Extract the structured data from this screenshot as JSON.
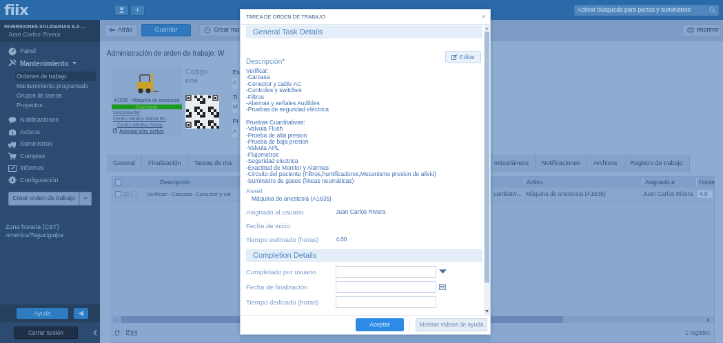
{
  "top_bar": {
    "logo": "fiix",
    "add_button": "+",
    "search": {
      "placeholder": "Activar búsqueda para piezas y suministros"
    }
  },
  "sidebar": {
    "company": "INVERSIONES SOLIDARIAS S.A ...",
    "user": "Juan Carlos Rivera",
    "items": [
      {
        "label": "Panel"
      },
      {
        "label": "Mantenimiento",
        "expanded": true,
        "children": [
          {
            "label": "Ordenes de trabajo",
            "selected": true
          },
          {
            "label": "Mantenimiento programado",
            "selected": false
          },
          {
            "label": "Grupos de tareas",
            "selected": false
          },
          {
            "label": "Proyectos",
            "selected": false
          }
        ]
      },
      {
        "label": "Notificaciones"
      },
      {
        "label": "Activos"
      },
      {
        "label": "Suministros"
      },
      {
        "label": "Compras"
      },
      {
        "label": "Informes"
      },
      {
        "label": "Configuración"
      }
    ],
    "create_button": "Crear orden de trabajo",
    "timezone": {
      "label": "Zona horaria (CST)",
      "value": "America/Tegucigalpa"
    },
    "help_button": "Ayuda",
    "logout_button": "Cerrar sesión"
  },
  "toolbar": {
    "back": "Atrás",
    "save": "Guardar",
    "create": "Crear ma",
    "print": "Imprimir"
  },
  "work_order": {
    "title": "Administración de orden de trabajo: W",
    "asset_card": {
      "name": "A1635 - Máquina de anestesia",
      "status": "Conectado",
      "disconnect": "Desconectar",
      "location": "Centro Medico Santa Ro",
      "sub_location": "Centro Médico Santa",
      "add_asset": "Agregar otro activo"
    },
    "code_label": "Código",
    "code": "6294",
    "cut_fields": [
      {
        "label": "Es",
        "value": "A"
      },
      {
        "label": "Ti",
        "value": "M"
      },
      {
        "label": "Pr",
        "value": "A"
      }
    ]
  },
  "tabs_left": [
    "General",
    "Finalización",
    "Tareas de ma"
  ],
  "tabs_right": [
    "misceláneos",
    "Notificaciones",
    "Archivos",
    "Registro de trabajo"
  ],
  "table": {
    "select_all_checked": false,
    "column_left": "Descripción",
    "columns_right": [
      "Activo",
      "Asignado a",
      "Horas"
    ],
    "row": {
      "checked": false,
      "description": "Verificar: -Carcasa -Conector y cal",
      "column_cut": "uantitativ...",
      "asset": "Máquina de anestesia (A1635)",
      "assigned": "Juan Carlos Rivera",
      "hours": "4.0"
    },
    "footer": "1 registro."
  },
  "dialog": {
    "title": "TAREA DE ORDEN DE TRABAJO",
    "close": "×",
    "general_header": "General Task Details",
    "edit_button": "Editar",
    "description_label": "Descripción*",
    "description_blocks": [
      [
        "Verificar:",
        "-Carcasa",
        "-Conector y cable AC",
        "-Controles y switches",
        "-Filtros",
        "-Alarmas y señales Audibles",
        "-Pruebas de seguridad eléctrica"
      ],
      [
        "Pruebas Cuantitativas:",
        "-Valvula Flush",
        "-Prueba de alta presion",
        "-Prueba de baja presion",
        "-Valvula APL",
        "-Flujometros",
        "-Seguridad electrica",
        "-Exactitud de Monitor y Alarmas",
        "-Circuito del paciente (Filtros,humificadores,Mecanismo presion de alivio)",
        "-Suministro de gases (líneas neumáticas)"
      ]
    ],
    "asset_label": "Asset",
    "asset_value": "Máquina de anestesia (A1635)",
    "fields": [
      {
        "label": "Asignado al usuario",
        "value": "Juan Carlos Rivera"
      },
      {
        "label": "Fecha de inicio"
      },
      {
        "label": "Tiempo estimado (horas)",
        "value": "4.00"
      }
    ],
    "completion_header": "Completion Details",
    "inputs": [
      {
        "label": "Completado por usuario",
        "kind": "dropdown"
      },
      {
        "label": "Fecha de finalización",
        "kind": "date"
      },
      {
        "label": "Tiempo dedicado (horas)",
        "kind": "text"
      }
    ],
    "accept_button": "Aceptar",
    "help_button": "Mostrar vídeos de ayuda"
  }
}
